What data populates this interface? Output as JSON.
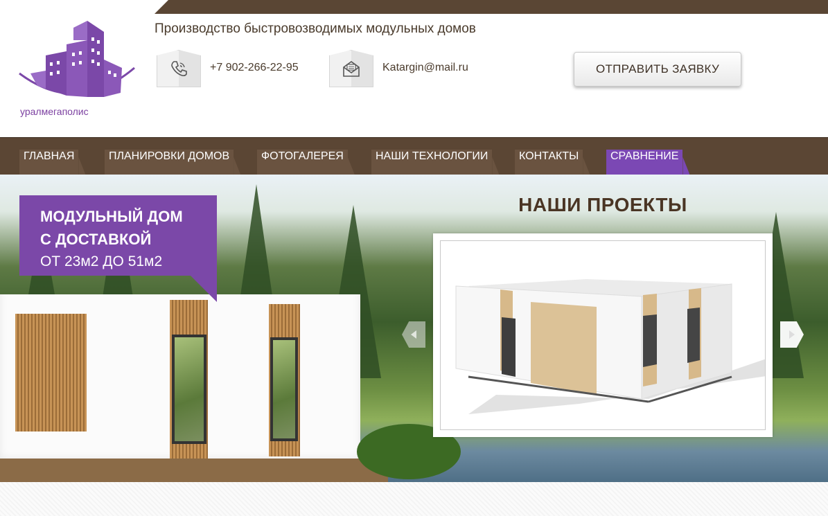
{
  "header": {
    "logo_text": "уралмегаполис",
    "tagline": "Производство быстровозводимых модульных домов",
    "phone": "+7 902-266-22-95",
    "email": "Katargin@mail.ru",
    "cta_label": "ОТПРАВИТЬ ЗАЯВКУ",
    "brand_color": "#7b48a8",
    "accent_brown": "#5b4634"
  },
  "nav": {
    "items": [
      {
        "label": "ГЛАВНАЯ",
        "active": false
      },
      {
        "label": "ПЛАНИРОВКИ ДОМОВ",
        "active": false
      },
      {
        "label": "ФОТОГАЛЕРЕЯ",
        "active": false
      },
      {
        "label": "НАШИ ТЕХНОЛОГИИ",
        "active": false
      },
      {
        "label": "КОНТАКТЫ",
        "active": false
      },
      {
        "label": "СРАВНЕНИЕ",
        "active": true
      }
    ]
  },
  "hero": {
    "promo_line1": "МОДУЛЬНЫЙ ДОМ",
    "promo_line2": "С ДОСТАВКОЙ",
    "promo_line3": "ОТ 23м2 ДО 51м2",
    "projects_title": "НАШИ ПРОЕКТЫ"
  },
  "icons": {
    "phone": "phone-icon",
    "email": "envelope-icon",
    "prev": "arrow-left-icon",
    "next": "arrow-right-icon"
  }
}
